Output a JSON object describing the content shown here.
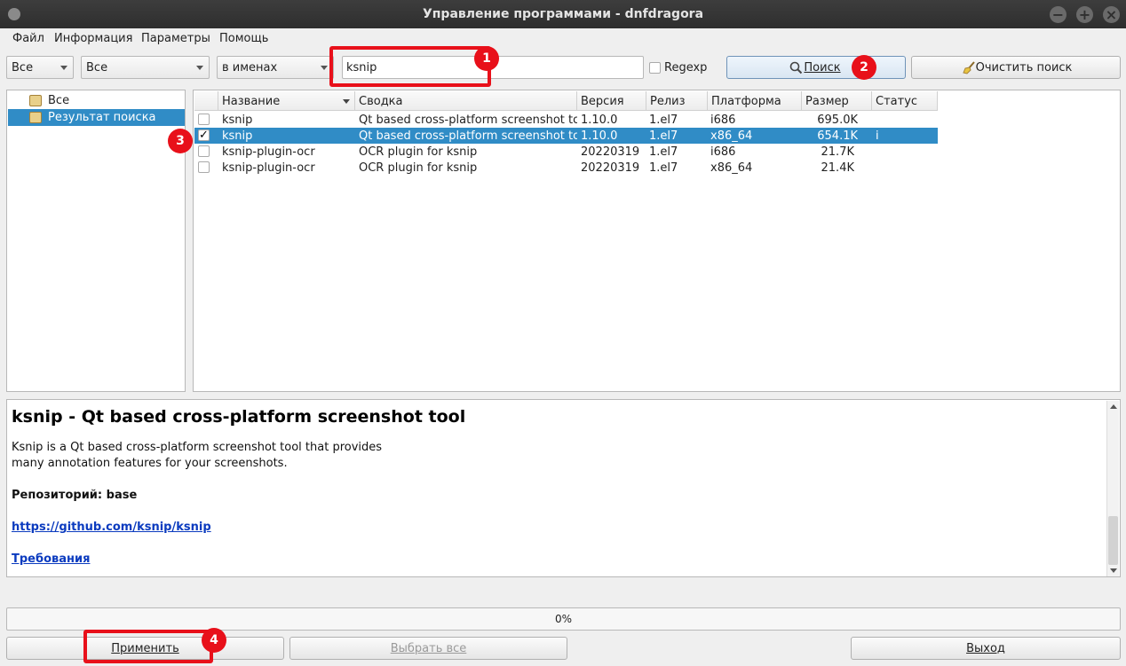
{
  "window": {
    "title": "Управление программами - dnfdragora"
  },
  "menu": [
    "Файл",
    "Информация",
    "Параметры",
    "Помощь"
  ],
  "filters": {
    "group": "Все",
    "status": "Все",
    "search_in": "в именах",
    "search_value": "ksnip",
    "regexp_label": "Regexp",
    "search_button": "Поиск",
    "clear_button": "Очистить поиск"
  },
  "tree": [
    {
      "label": "Все"
    },
    {
      "label": "Результат поиска"
    }
  ],
  "table": {
    "columns": [
      "Название",
      "Сводка",
      "Версия",
      "Релиз",
      "Платформа",
      "Размер",
      "Статус"
    ],
    "rows": [
      {
        "checked": false,
        "name": "ksnip",
        "summary": "Qt based cross-platform screenshot tool",
        "version": "1.10.0",
        "release": "1.el7",
        "arch": "i686",
        "size": "695.0K",
        "status": ""
      },
      {
        "checked": true,
        "name": "ksnip",
        "summary": "Qt based cross-platform screenshot tool",
        "version": "1.10.0",
        "release": "1.el7",
        "arch": "x86_64",
        "size": "654.1K",
        "status": "i"
      },
      {
        "checked": false,
        "name": "ksnip-plugin-ocr",
        "summary": "OCR plugin for ksnip",
        "version": "20220319",
        "release": "1.el7",
        "arch": "i686",
        "size": "21.7K",
        "status": ""
      },
      {
        "checked": false,
        "name": "ksnip-plugin-ocr",
        "summary": "OCR plugin for ksnip",
        "version": "20220319",
        "release": "1.el7",
        "arch": "x86_64",
        "size": "21.4K",
        "status": ""
      }
    ]
  },
  "details": {
    "title": "ksnip - Qt based cross-platform screenshot tool",
    "desc_line1": "Ksnip is a Qt based cross-platform screenshot tool that provides",
    "desc_line2": "many annotation features for your screenshots.",
    "repo": "Репозиторий: base",
    "url": "https://github.com/ksnip/ksnip",
    "requirements": "Требования"
  },
  "progress": {
    "label": "0%",
    "value": 0
  },
  "buttons": {
    "apply": "Применить",
    "select_all": "Выбрать все",
    "exit": "Выход"
  },
  "markers": [
    "1",
    "2",
    "3",
    "4"
  ],
  "colors": {
    "selection": "#308cc6",
    "marker": "#e8101a",
    "link": "#0b3bbf"
  }
}
